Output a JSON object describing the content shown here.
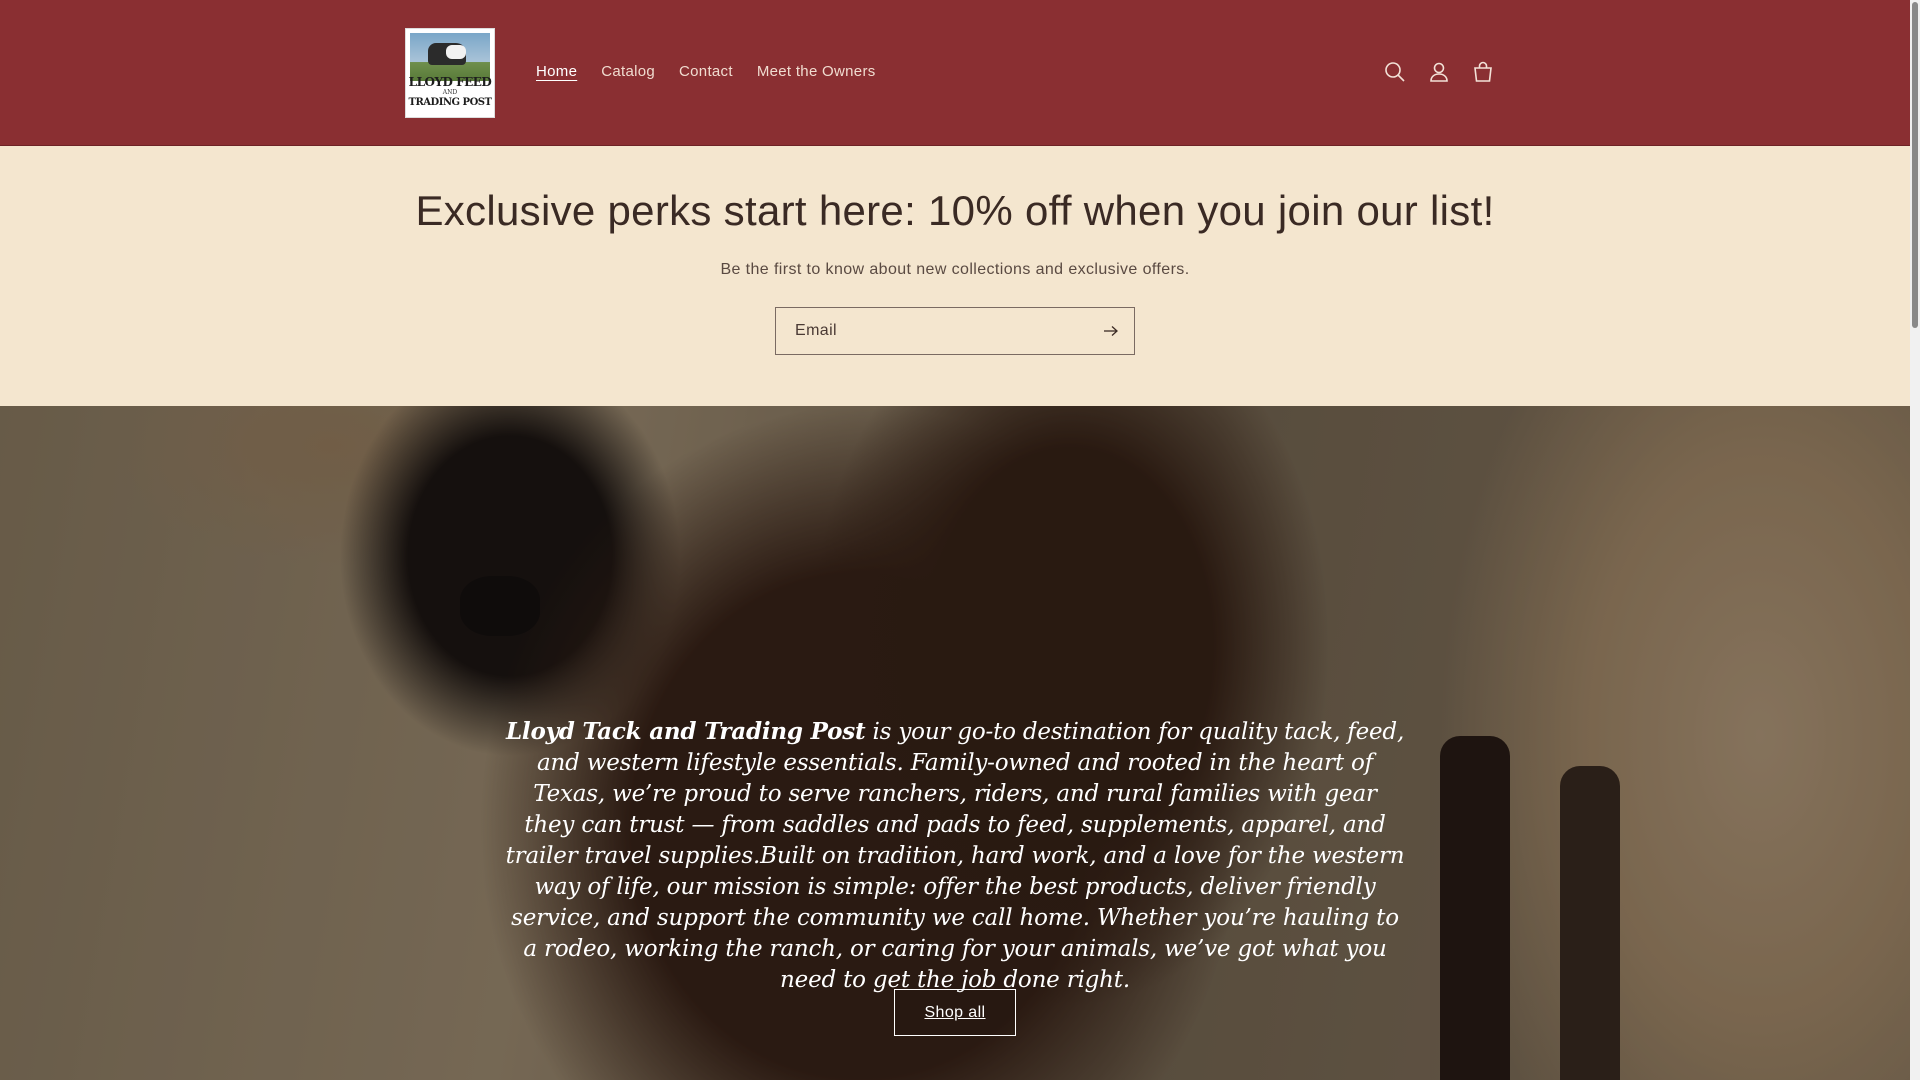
{
  "header": {
    "logo": {
      "line1": "LLOYD FEED",
      "line2": "AND",
      "line3": "TRADING POST"
    },
    "nav": [
      {
        "label": "Home",
        "active": true
      },
      {
        "label": "Catalog"
      },
      {
        "label": "Contact"
      },
      {
        "label": "Meet the Owners"
      }
    ],
    "icons": [
      "search-icon",
      "account-icon",
      "cart-icon"
    ],
    "background_color": "#8a2f32"
  },
  "newsletter": {
    "title": "Exclusive perks start here: 10% off when you join our list!",
    "subtitle": "Be the first to know about new collections and exclusive offers.",
    "email_placeholder": "Email",
    "submit_icon": "arrow-right-icon",
    "background_color": "#f4e6cf"
  },
  "hero": {
    "brand_name": "Lloyd Tack and Trading Post",
    "description": " is your go-to destination for quality tack, feed, and western lifestyle essentials. Family-owned and rooted in the heart of Texas, we’re proud to serve ranchers, riders, and rural families with gear they can trust — from saddles and pads to feed, supplements, apparel, and trailer travel supplies.Built on tradition, hard work, and a love for the western way of life, our mission is simple: offer the best products, deliver friendly service, and support the community we call home. Whether you’re hauling to a rodeo, working the ranch, or caring for your animals, we’ve got what you need to get the job done right.",
    "button_label": "Shop all"
  }
}
